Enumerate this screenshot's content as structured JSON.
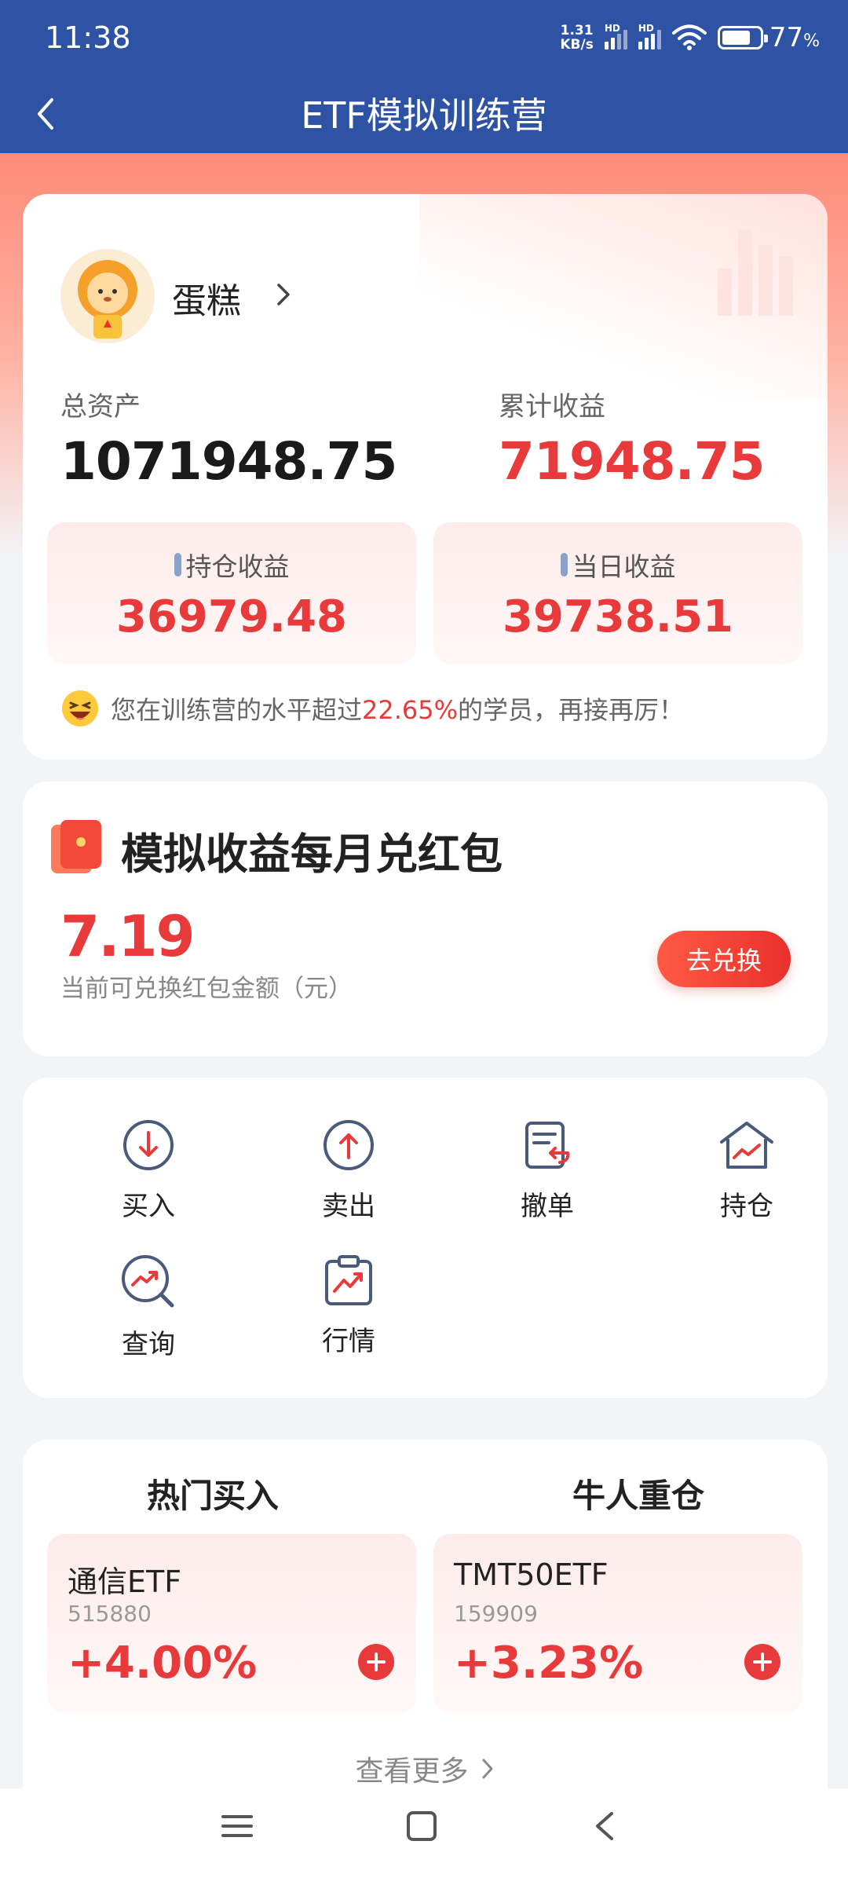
{
  "status_bar": {
    "time": "11:38",
    "net_speed_value": "1.31",
    "net_speed_unit": "KB/s",
    "signal_label": "HD",
    "battery_percent": "77",
    "battery_unit": "%",
    "battery_level": 0.77
  },
  "nav": {
    "title": "ETF模拟训练营",
    "back_icon": "chevron-left-icon"
  },
  "user": {
    "name": "蛋糕"
  },
  "assets": {
    "total_label": "总资产",
    "total_value": "1071948.75",
    "cum_label": "累计收益",
    "cum_value": "71948.75",
    "hold_label": "持仓收益",
    "hold_value": "36979.48",
    "today_label": "当日收益",
    "today_value": "39738.51",
    "rank_prefix": "您在训练营的水平超过",
    "rank_pct": "22.65%",
    "rank_suffix": "的学员，再接再厉！"
  },
  "packet": {
    "title": "模拟收益每月兑红包",
    "amount": "7.19",
    "desc": "当前可兑换红包金额（元）",
    "button": "去兑换"
  },
  "actions": [
    {
      "label": "买入",
      "icon": "buy-arrow-down-icon"
    },
    {
      "label": "卖出",
      "icon": "sell-arrow-up-icon"
    },
    {
      "label": "撤单",
      "icon": "cancel-order-icon"
    },
    {
      "label": "持仓",
      "icon": "holdings-house-icon"
    },
    {
      "label": "查询",
      "icon": "query-search-icon"
    },
    {
      "label": "行情",
      "icon": "market-clipboard-icon"
    }
  ],
  "hot": {
    "tab_hot": "热门买入",
    "tab_heavy": "牛人重仓",
    "active_tab": "牛人重仓",
    "items": [
      {
        "name": "通信ETF",
        "code": "515880",
        "change": "+4.00%"
      },
      {
        "name": "TMT50ETF",
        "code": "159909",
        "change": "+3.23%"
      }
    ],
    "more": "查看更多"
  },
  "colors": {
    "header_blue": "#2e52a4",
    "accent_red": "#e83a3a"
  }
}
